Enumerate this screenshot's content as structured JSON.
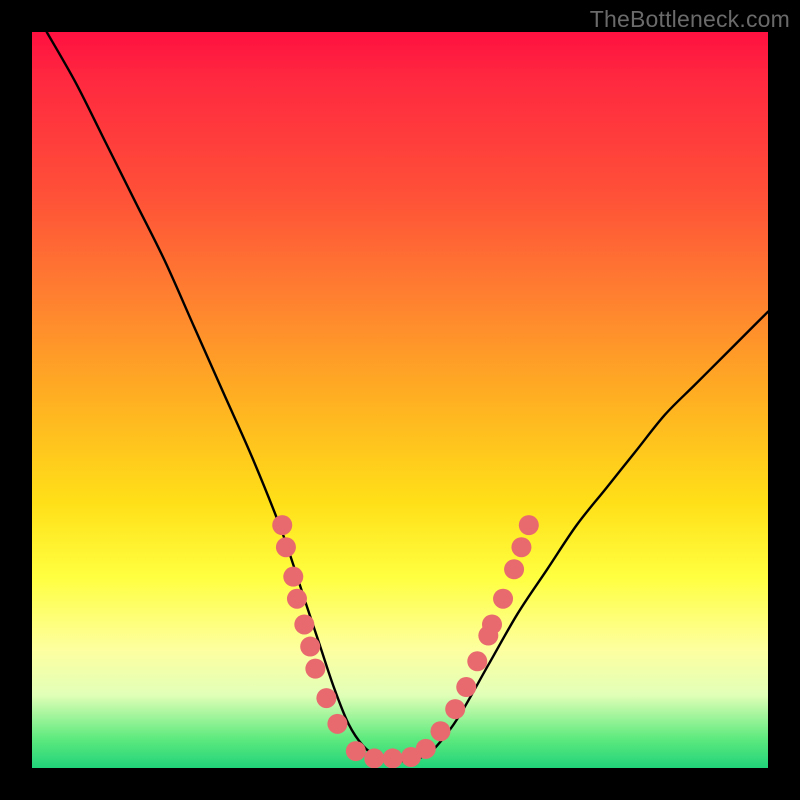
{
  "watermark": "TheBottleneck.com",
  "chart_data": {
    "type": "line",
    "title": "",
    "xlabel": "",
    "ylabel": "",
    "xlim": [
      0,
      100
    ],
    "ylim": [
      0,
      100
    ],
    "series": [
      {
        "name": "bottleneck-curve",
        "x": [
          2,
          6,
          10,
          14,
          18,
          22,
          26,
          30,
          34,
          37,
          39,
          41,
          43,
          45,
          47,
          49,
          51,
          53,
          55,
          58,
          62,
          66,
          70,
          74,
          78,
          82,
          86,
          90,
          94,
          98,
          100
        ],
        "y": [
          100,
          93,
          85,
          77,
          69,
          60,
          51,
          42,
          32,
          23,
          17,
          11,
          6,
          3,
          1.5,
          1,
          1,
          1.5,
          3,
          7,
          14,
          21,
          27,
          33,
          38,
          43,
          48,
          52,
          56,
          60,
          62
        ]
      }
    ],
    "markers": {
      "name": "sample-points",
      "color": "#e86a6f",
      "radius_px": 10,
      "points": [
        {
          "x": 34.0,
          "y": 33.0
        },
        {
          "x": 34.5,
          "y": 30.0
        },
        {
          "x": 35.5,
          "y": 26.0
        },
        {
          "x": 36.0,
          "y": 23.0
        },
        {
          "x": 37.0,
          "y": 19.5
        },
        {
          "x": 37.8,
          "y": 16.5
        },
        {
          "x": 38.5,
          "y": 13.5
        },
        {
          "x": 40.0,
          "y": 9.5
        },
        {
          "x": 41.5,
          "y": 6.0
        },
        {
          "x": 44.0,
          "y": 2.3
        },
        {
          "x": 46.5,
          "y": 1.3
        },
        {
          "x": 49.0,
          "y": 1.3
        },
        {
          "x": 51.5,
          "y": 1.5
        },
        {
          "x": 53.5,
          "y": 2.6
        },
        {
          "x": 55.5,
          "y": 5.0
        },
        {
          "x": 57.5,
          "y": 8.0
        },
        {
          "x": 59.0,
          "y": 11.0
        },
        {
          "x": 60.5,
          "y": 14.5
        },
        {
          "x": 62.0,
          "y": 18.0
        },
        {
          "x": 62.5,
          "y": 19.5
        },
        {
          "x": 64.0,
          "y": 23.0
        },
        {
          "x": 65.5,
          "y": 27.0
        },
        {
          "x": 66.5,
          "y": 30.0
        },
        {
          "x": 67.5,
          "y": 33.0
        }
      ]
    }
  }
}
